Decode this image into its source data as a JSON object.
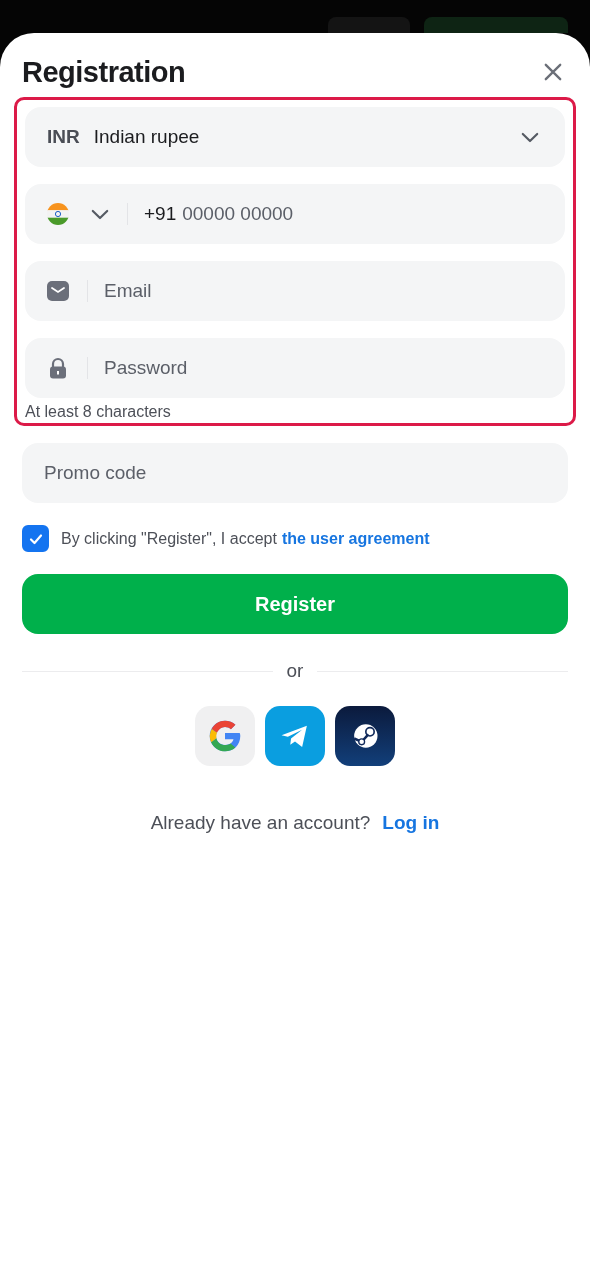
{
  "dialog": {
    "title": "Registration"
  },
  "form_group": {
    "highlighted": true,
    "currency": {
      "code": "INR",
      "name": "Indian rupee"
    },
    "phone": {
      "prefix": "+91",
      "placeholder": "00000 00000"
    },
    "email": {
      "placeholder": "Email"
    },
    "password": {
      "placeholder": "Password",
      "hint": "At least 8 characters"
    }
  },
  "promo": {
    "placeholder": "Promo code"
  },
  "agreement": {
    "checked": true,
    "text": "By clicking \"Register\", I accept",
    "link": "the user agreement"
  },
  "register_button": "Register",
  "divider": "or",
  "social": [
    {
      "kind": "google"
    },
    {
      "kind": "telegram"
    },
    {
      "kind": "steam"
    }
  ],
  "login": {
    "text": "Already have an account?",
    "link": "Log in"
  }
}
